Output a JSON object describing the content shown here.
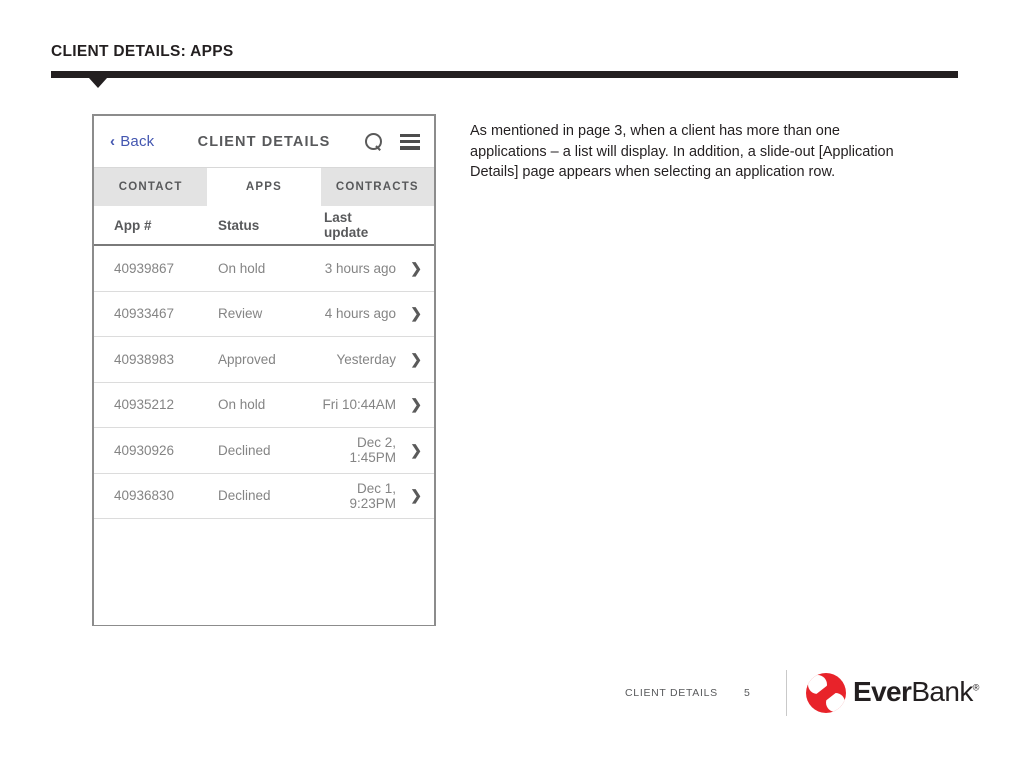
{
  "slide": {
    "title": "CLIENT DETAILS: APPS"
  },
  "body_copy": {
    "text": "As mentioned in page 3, when a client has more than one applications – a list will display. In addition, a slide-out [Application Details] page appears when selecting an application row."
  },
  "mockup": {
    "appbar": {
      "back_label": "Back",
      "back_chevron": "‹",
      "title": "CLIENT DETAILS",
      "search_icon": "search-icon",
      "menu_icon": "hamburger-menu-icon"
    },
    "tabs": [
      {
        "label": "CONTACT",
        "active": false
      },
      {
        "label": "APPS",
        "active": true
      },
      {
        "label": "CONTRACTS",
        "active": false
      }
    ],
    "table": {
      "headers": {
        "app": "App #",
        "status": "Status",
        "last_update": "Last update"
      },
      "rows": [
        {
          "app": "40939867",
          "status": "On hold",
          "last_update": "3 hours ago",
          "arrow": "❯"
        },
        {
          "app": "40933467",
          "status": "Review",
          "last_update": "4 hours ago",
          "arrow": "❯"
        },
        {
          "app": "40938983",
          "status": "Approved",
          "last_update": "Yesterday",
          "arrow": "❯"
        },
        {
          "app": "40935212",
          "status": "On hold",
          "last_update": "Fri 10:44AM",
          "arrow": "❯"
        },
        {
          "app": "40930926",
          "status": "Declined",
          "last_update": "Dec 2, 1:45PM",
          "arrow": "❯"
        },
        {
          "app": "40936830",
          "status": "Declined",
          "last_update": "Dec 1, 9:23PM",
          "arrow": "❯"
        }
      ]
    }
  },
  "footer": {
    "label": "CLIENT DETAILS",
    "page_number": "5",
    "logo_ever": "Ever",
    "logo_bank": "Bank",
    "logo_reg": "®"
  },
  "colors": {
    "title_bar": "#231f20",
    "back_link": "#4356b0",
    "tab_inactive_bg": "#e3e3e3",
    "row_text": "#848484",
    "brand_red": "#e8232a"
  }
}
